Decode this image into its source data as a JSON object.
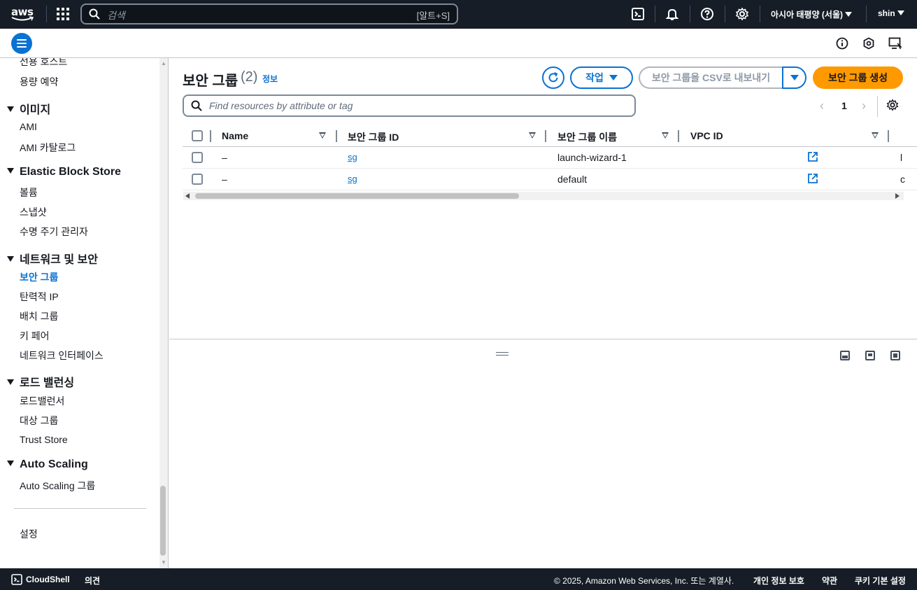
{
  "topnav": {
    "logo_text": "aws",
    "search_placeholder": "검색",
    "search_shortcut": "[알트+S]",
    "region": "아시아 태평양 (서울)",
    "user": "shin"
  },
  "sidebar": {
    "items_top": [
      "전용 호스트",
      "용량 예약"
    ],
    "sections": [
      {
        "title": "이미지",
        "items": [
          "AMI",
          "AMI 카탈로그"
        ]
      },
      {
        "title": "Elastic Block Store",
        "items": [
          "볼륨",
          "스냅샷",
          "수명 주기 관리자"
        ]
      },
      {
        "title": "네트워크 및 보안",
        "items": [
          "보안 그룹",
          "탄력적 IP",
          "배치 그룹",
          "키 페어",
          "네트워크 인터페이스"
        ]
      },
      {
        "title": "로드 밸런싱",
        "items": [
          "로드밸런서",
          "대상 그룹",
          "Trust Store"
        ]
      },
      {
        "title": "Auto Scaling",
        "items": [
          "Auto Scaling 그룹"
        ]
      }
    ],
    "settings": "설정"
  },
  "main": {
    "title": "보안 그룹",
    "count": "(2)",
    "info": "정보",
    "actions_label": "작업",
    "csv_label": "보안 그룹을 CSV로 내보내기",
    "create_label": "보안 그룹 생성",
    "filter_placeholder": "Find resources by attribute or tag",
    "page": "1",
    "columns": [
      "Name",
      "보안 그룹 ID",
      "보안 그룹 이름",
      "VPC ID"
    ],
    "rows": [
      {
        "name": "–",
        "id": "sg",
        "group_name": "launch-wizard-1",
        "extra": "l"
      },
      {
        "name": "–",
        "id": "sg",
        "group_name": "default",
        "extra": "c"
      }
    ]
  },
  "footer": {
    "cloudshell": "CloudShell",
    "feedback": "의견",
    "copyright": "© 2025, Amazon Web Services, Inc. 또는 계열사.",
    "privacy": "개인 정보 보호",
    "terms": "약관",
    "cookies": "쿠키 기본 설정"
  },
  "colors": {
    "nav_bg": "#161d26",
    "accent": "#0972d3",
    "primary_button": "#ff9900"
  }
}
